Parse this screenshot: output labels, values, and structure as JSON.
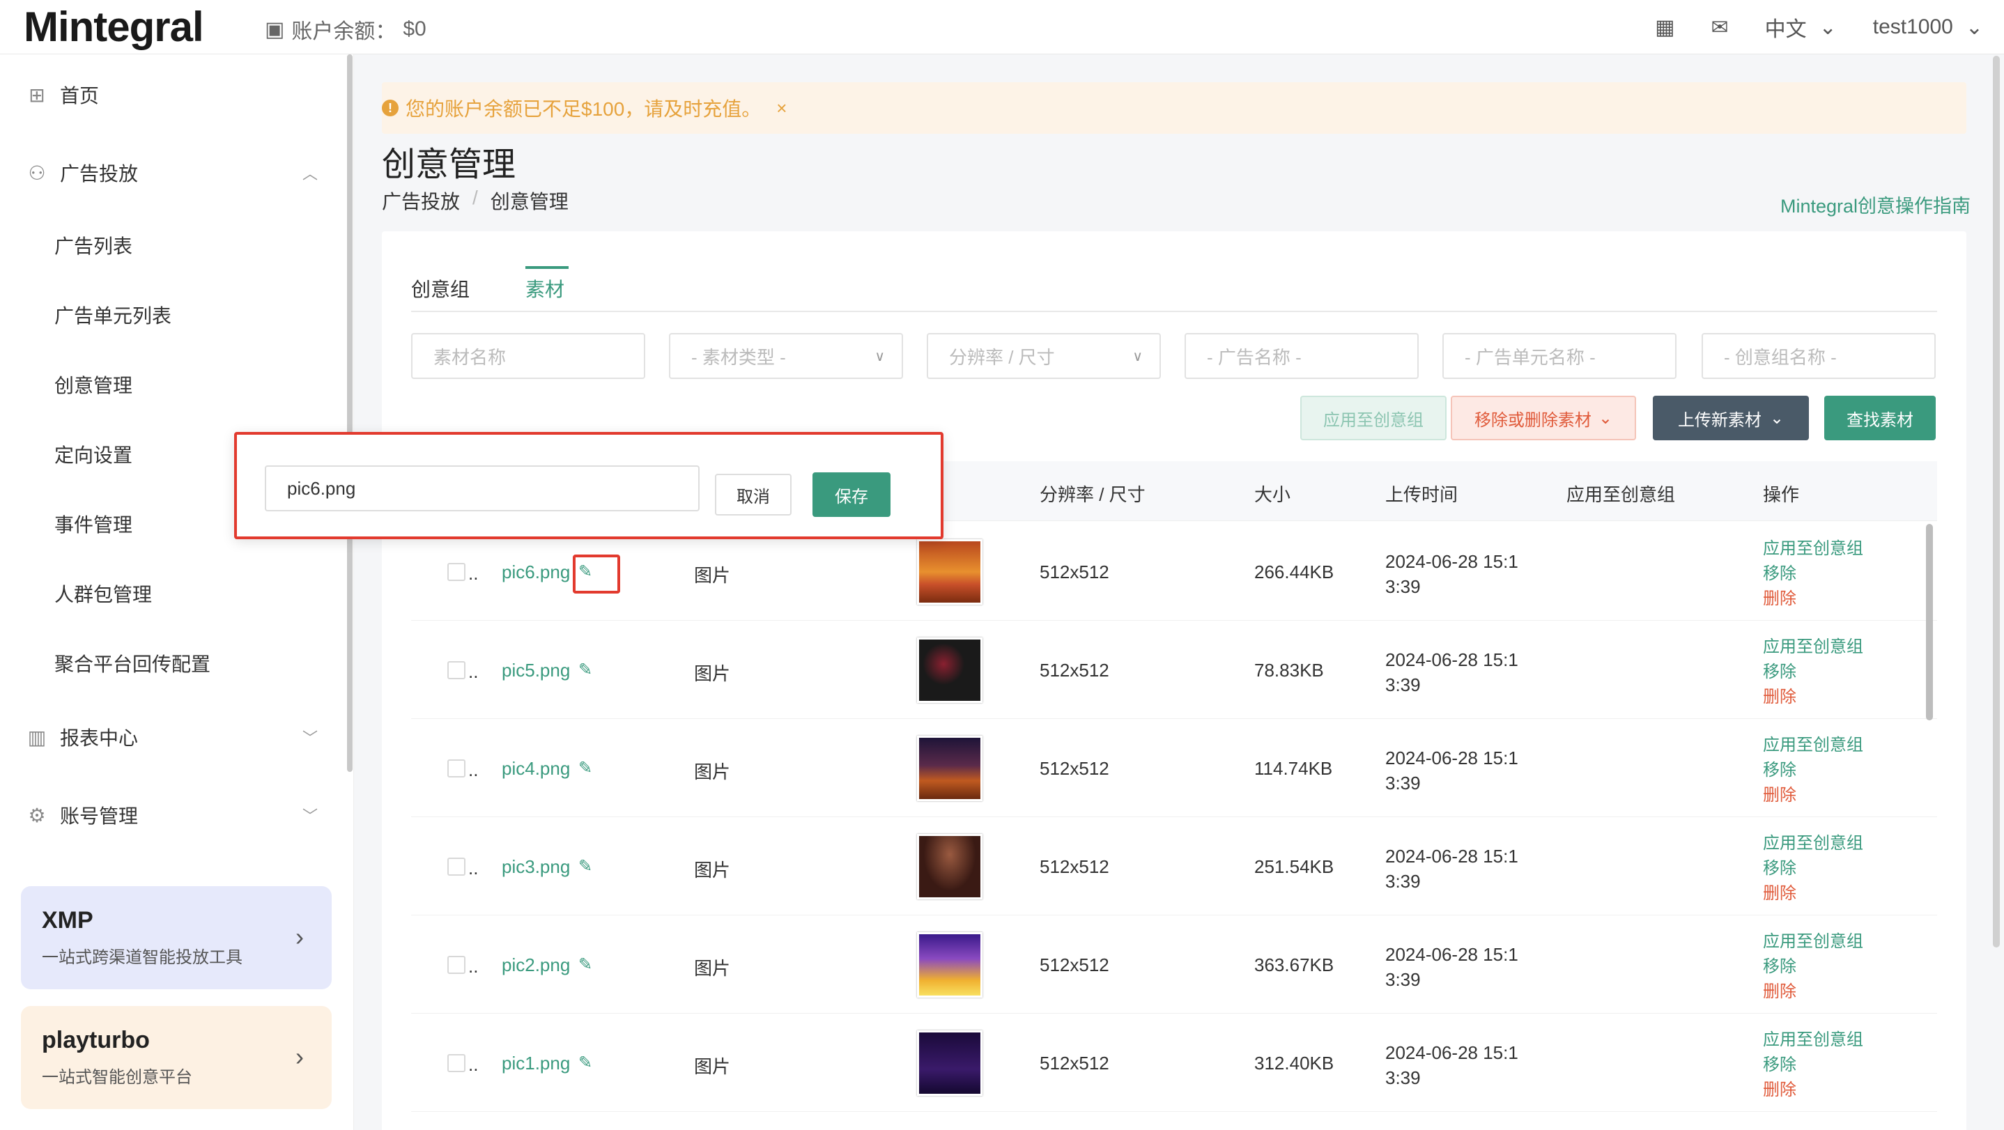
{
  "app": {
    "logo": "Mintegral",
    "balance_label": "账户余额：",
    "balance_value": "$0"
  },
  "topbar": {
    "lang": "中文",
    "user": "test1000"
  },
  "sidebar": {
    "home": "首页",
    "ads": "广告投放",
    "sub": [
      "广告列表",
      "广告单元列表",
      "创意管理",
      "定向设置",
      "事件管理",
      "人群包管理",
      "聚合平台回传配置"
    ],
    "reports": "报表中心",
    "account": "账号管理",
    "promo1": {
      "title": "XMP",
      "desc": "一站式跨渠道智能投放工具"
    },
    "promo2": {
      "title": "playturbo",
      "desc": "一站式智能创意平台"
    }
  },
  "alert": {
    "text": "您的账户余额已不足$100，请及时充值。"
  },
  "page": {
    "title": "创意管理",
    "crumb1": "广告投放",
    "crumb2": "创意管理",
    "guide": "Mintegral创意操作指南"
  },
  "tabs": [
    "创意组",
    "素材"
  ],
  "filters": [
    "素材名称",
    "- 素材类型 -",
    "分辨率 / 尺寸",
    "- 广告名称 -",
    "- 广告单元名称 -",
    "- 创意组名称 -"
  ],
  "buttons": {
    "apply": "应用至创意组",
    "remove": "移除或删除素材",
    "upload": "上传新素材",
    "search": "查找素材"
  },
  "columns": [
    "分辨率 / 尺寸",
    "大小",
    "上传时间",
    "应用至创意组",
    "操作"
  ],
  "rows": [
    {
      "name": "pic6.png",
      "type": "图片",
      "res": "512x512",
      "size": "266.44KB",
      "time1": "2024-06-28 15:1",
      "time2": "3:39"
    },
    {
      "name": "pic5.png",
      "type": "图片",
      "res": "512x512",
      "size": "78.83KB",
      "time1": "2024-06-28 15:1",
      "time2": "3:39"
    },
    {
      "name": "pic4.png",
      "type": "图片",
      "res": "512x512",
      "size": "114.74KB",
      "time1": "2024-06-28 15:1",
      "time2": "3:39"
    },
    {
      "name": "pic3.png",
      "type": "图片",
      "res": "512x512",
      "size": "251.54KB",
      "time1": "2024-06-28 15:1",
      "time2": "3:39"
    },
    {
      "name": "pic2.png",
      "type": "图片",
      "res": "512x512",
      "size": "363.67KB",
      "time1": "2024-06-28 15:1",
      "time2": "3:39"
    },
    {
      "name": "pic1.png",
      "type": "图片",
      "res": "512x512",
      "size": "312.40KB",
      "time1": "2024-06-28 15:1",
      "time2": "3:39"
    }
  ],
  "row_ops": {
    "apply": "应用至创意组",
    "remove": "移除",
    "delete": "删除"
  },
  "popup": {
    "value": "pic6.png",
    "cancel": "取消",
    "save": "保存"
  }
}
